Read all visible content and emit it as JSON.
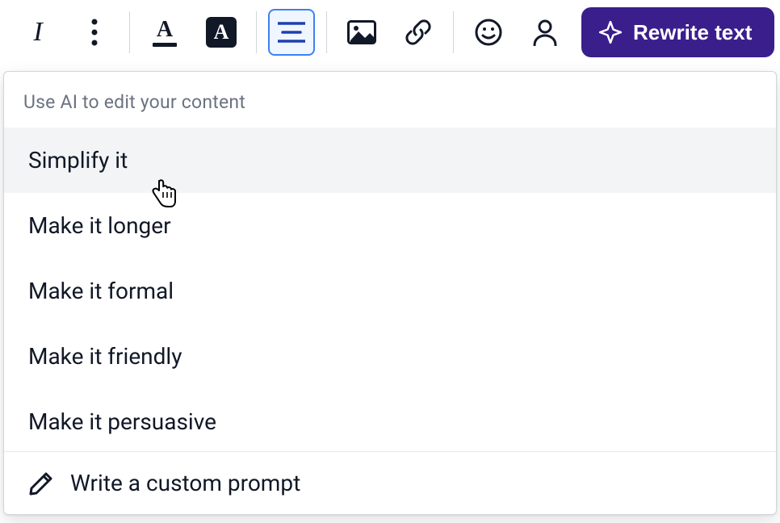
{
  "toolbar": {
    "rewrite_label": "Rewrite text"
  },
  "dropdown": {
    "header": "Use AI to edit your content",
    "items": [
      "Simplify it",
      "Make it longer",
      "Make it formal",
      "Make it friendly",
      "Make it persuasive"
    ],
    "custom_prompt_label": "Write a custom prompt"
  }
}
